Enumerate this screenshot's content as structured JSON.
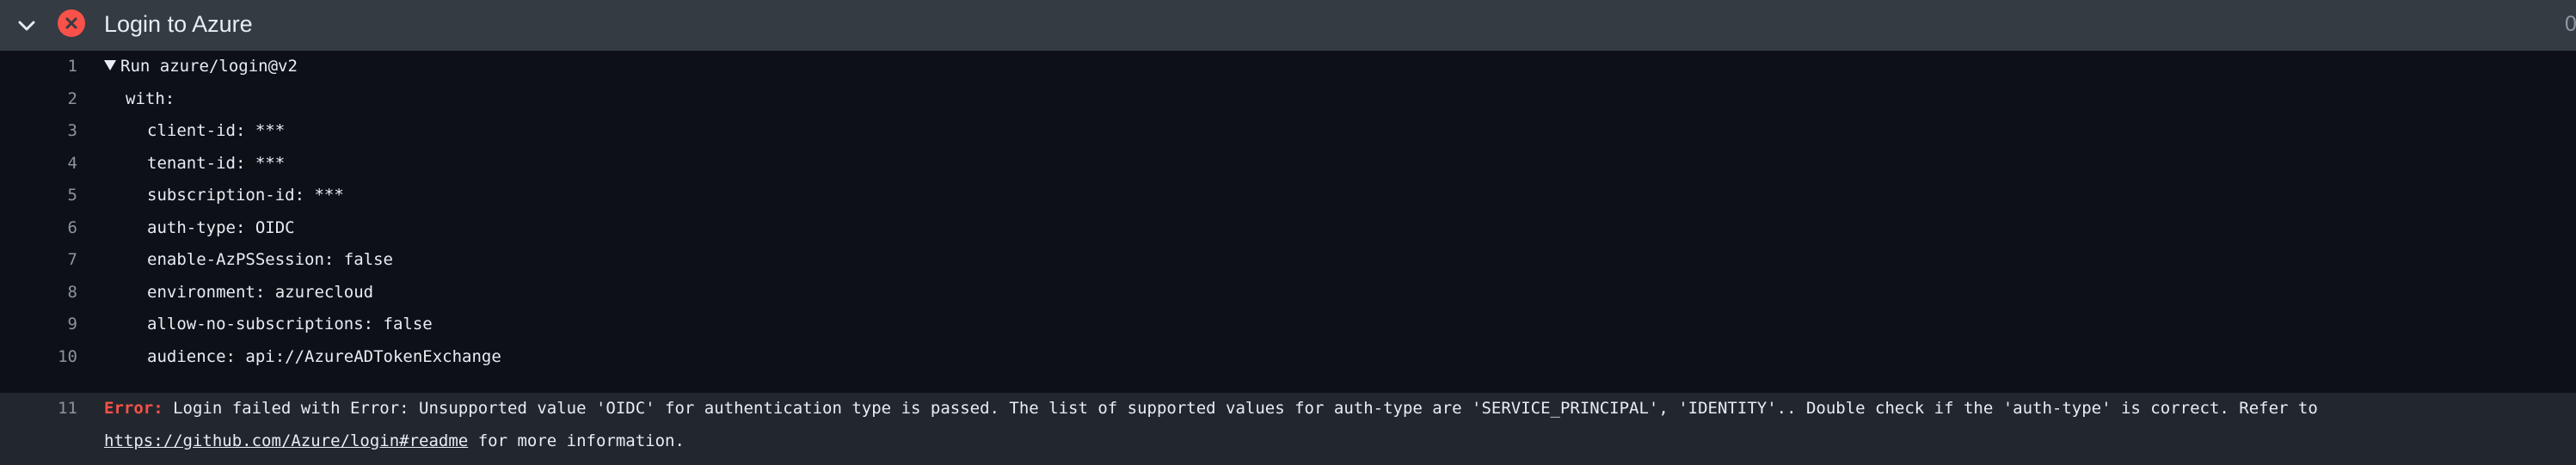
{
  "header": {
    "title": "Login to Azure",
    "duration": "0",
    "status": "failed"
  },
  "colors": {
    "header_bg": "#343b43",
    "log_bg": "#0d1117",
    "error_bg": "#22272e",
    "error_red": "#f85149"
  },
  "log": {
    "lines": [
      {
        "num": "1",
        "text": "Run azure/login@v2"
      },
      {
        "num": "2",
        "text": "with:"
      },
      {
        "num": "3",
        "text": "client-id: ***"
      },
      {
        "num": "4",
        "text": "tenant-id: ***"
      },
      {
        "num": "5",
        "text": "subscription-id: ***"
      },
      {
        "num": "6",
        "text": "auth-type: OIDC"
      },
      {
        "num": "7",
        "text": "enable-AzPSSession: false"
      },
      {
        "num": "8",
        "text": "environment: azurecloud"
      },
      {
        "num": "9",
        "text": "allow-no-subscriptions: false"
      },
      {
        "num": "10",
        "text": "audience: api://AzureADTokenExchange"
      }
    ],
    "error": {
      "num": "11",
      "label": "Error:",
      "message": " Login failed with Error: Unsupported value 'OIDC' for authentication type is passed. The list of supported values for auth-type are 'SERVICE_PRINCIPAL', 'IDENTITY'.. Double check if the 'auth-type' is correct. Refer to",
      "link": "https://github.com/Azure/login#readme",
      "suffix": " for more information."
    }
  }
}
